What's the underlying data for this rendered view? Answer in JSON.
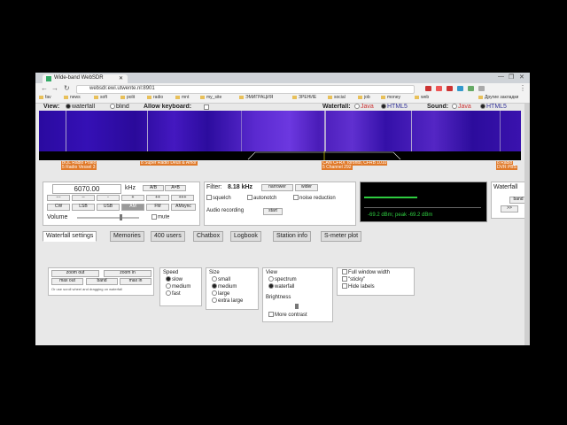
{
  "browser": {
    "tab_title": "Wide-band WebSDR",
    "url": "websdr.ewi.utwente.nl:8901",
    "window_controls": [
      "—",
      "❐",
      "✕"
    ],
    "bookmarks": [
      "fav",
      "news",
      "soft",
      "polit",
      "radio",
      "mnt",
      "my_site",
      "ЭМИГРАЦИЯ",
      "ЗРЕНИЕ",
      "social",
      "job",
      "money",
      "web",
      "Другие закладки"
    ]
  },
  "top": {
    "view_label": "View:",
    "view_options": [
      "waterfall",
      "blind"
    ],
    "allow_keyboard_label": "Allow keyboard:",
    "waterfall_label": "Waterfall:",
    "waterfall_options": [
      "Java",
      "HTML5"
    ],
    "sound_label": "Sound:",
    "sound_options": [
      "Java",
      "HTML5"
    ]
  },
  "stations": [
    {
      "text": "BOL Radio Poleo"
    },
    {
      "text": "5 Radio Vessel 3"
    },
    {
      "text": "8 Super Radio Deus & Amor"
    },
    {
      "text": "CAN CFRX Toronto, CFRB 1010"
    },
    {
      "text": "5 Channel 292"
    },
    {
      "text": "8 Radio"
    },
    {
      "text": "DVR PBS"
    }
  ],
  "tuning": {
    "frequency": "6070.00",
    "unit": "kHz",
    "ab": [
      "A/B",
      "A=B"
    ],
    "step_buttons": [
      "---",
      "--",
      "-",
      "+",
      "++",
      "+++"
    ],
    "modes": [
      "CW",
      "LSB",
      "USB",
      "AM",
      "FM",
      "AMsync"
    ],
    "active_mode": "AM",
    "volume_label": "Volume",
    "mute_label": "mute"
  },
  "filter": {
    "label": "Filter:",
    "value": "8.18 kHz",
    "narrower": "narrower",
    "wider": "wider",
    "squelch": "squelch",
    "autonotch": "autonotch",
    "noise_reduction": "noise reduction",
    "audio_recording": "Audio recording",
    "start": "start"
  },
  "meter": {
    "text": "-69.2 dBm; peak  -69.2 dBm"
  },
  "right_panel": {
    "label": "Waterfall",
    "buttons": [
      "band",
      ">>"
    ]
  },
  "tabs": [
    "Waterfall settings",
    "Memories",
    "400 users",
    "Chatbox",
    "Logbook",
    "Station info",
    "S-meter plot"
  ],
  "active_tab": "Waterfall settings",
  "zoom": {
    "zoom_out": "zoom out",
    "zoom_in": "zoom in",
    "hint": "Or use scroll wheel and dragging on waterfall",
    "max_out": "max out",
    "band": "band",
    "max_in": "max in"
  },
  "speed": {
    "label": "Speed",
    "options": [
      "slow",
      "medium",
      "fast"
    ],
    "selected": "slow"
  },
  "size": {
    "label": "Size",
    "options": [
      "small",
      "medium",
      "large",
      "extra large"
    ],
    "selected": "medium"
  },
  "view2": {
    "label": "View",
    "options": [
      "spectrum",
      "waterfall"
    ],
    "selected": "waterfall"
  },
  "brightness": {
    "label": "Brightness",
    "more_contrast": "More contrast"
  },
  "window": {
    "options": [
      "Full window width",
      "\"sticky\"",
      "Hide labels"
    ]
  },
  "colors": {
    "waterfall_dark": "#2a0aa0",
    "station_label": "#e07a2a",
    "meter_green": "#2ecc40"
  }
}
